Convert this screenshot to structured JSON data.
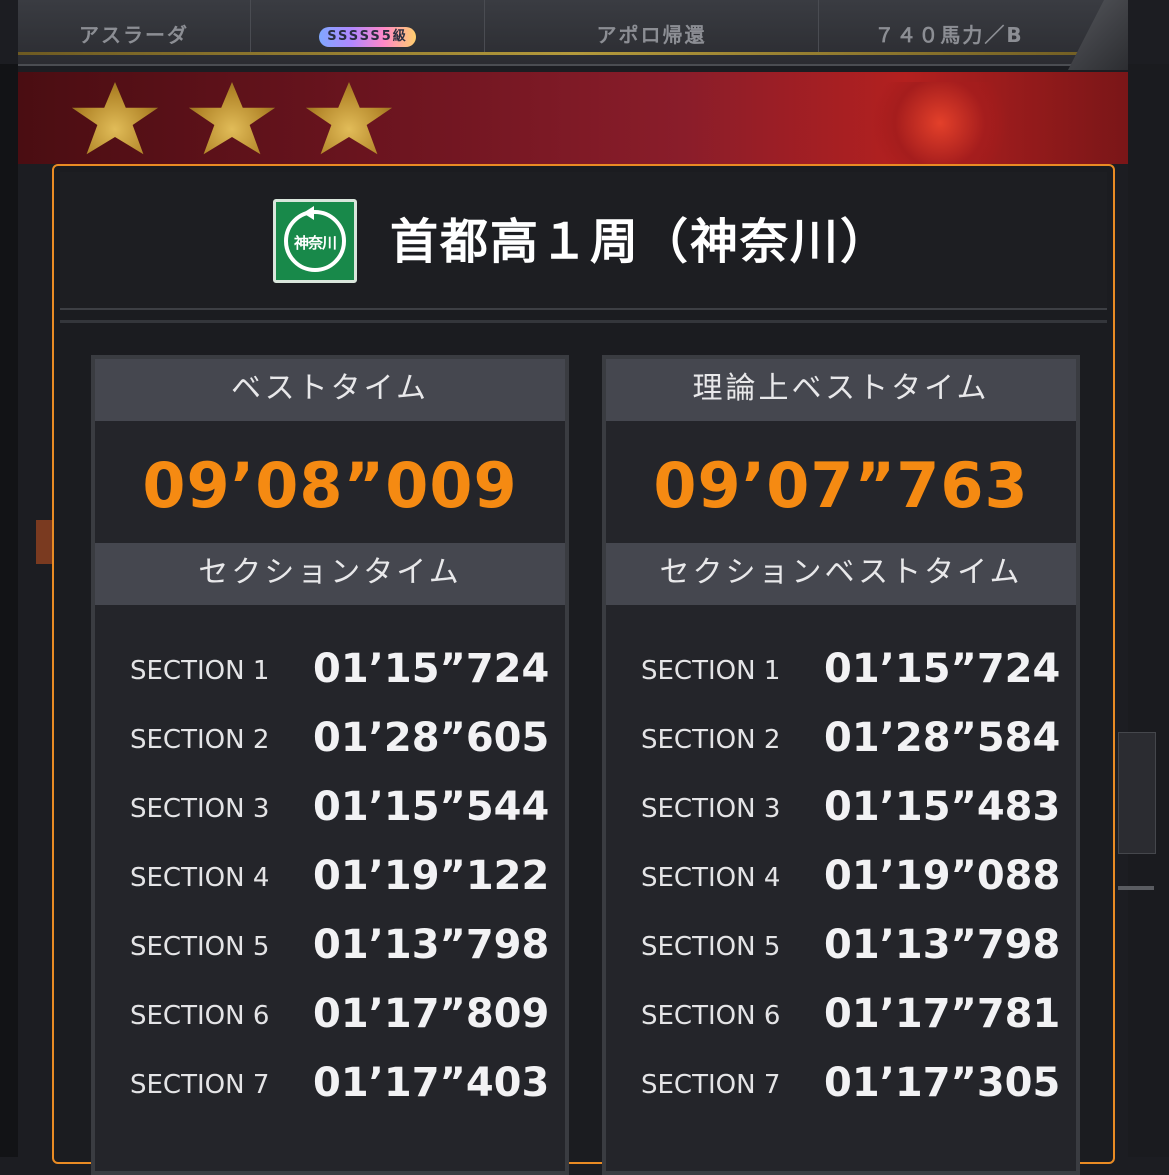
{
  "top_bar": {
    "car_name": "アスラーダ",
    "rank": "SSSSS5級",
    "team": "アポロ帰還",
    "power": "７４０馬力／B"
  },
  "dialog": {
    "course_icon_label": "神奈川",
    "course_title": "首都高１周（神奈川）",
    "best": {
      "header": "ベストタイム",
      "time": "09’08”009",
      "sections_header": "セクションタイム",
      "sections": [
        {
          "label": "SECTION 1",
          "time": "01’15”724"
        },
        {
          "label": "SECTION 2",
          "time": "01’28”605"
        },
        {
          "label": "SECTION 3",
          "time": "01’15”544"
        },
        {
          "label": "SECTION 4",
          "time": "01’19”122"
        },
        {
          "label": "SECTION 5",
          "time": "01’13”798"
        },
        {
          "label": "SECTION 6",
          "time": "01’17”809"
        },
        {
          "label": "SECTION 7",
          "time": "01’17”403"
        }
      ]
    },
    "theoretical": {
      "header": "理論上ベストタイム",
      "time": "09’07”763",
      "sections_header": "セクションベストタイム",
      "sections": [
        {
          "label": "SECTION 1",
          "time": "01’15”724"
        },
        {
          "label": "SECTION 2",
          "time": "01’28”584"
        },
        {
          "label": "SECTION 3",
          "time": "01’15”483"
        },
        {
          "label": "SECTION 4",
          "time": "01’19”088"
        },
        {
          "label": "SECTION 5",
          "time": "01’13”798"
        },
        {
          "label": "SECTION 6",
          "time": "01’17”781"
        },
        {
          "label": "SECTION 7",
          "time": "01’17”305"
        }
      ]
    }
  },
  "colors": {
    "accent_orange": "#f58a12",
    "dialog_border": "#e98b24",
    "course_icon_green": "#18894a"
  }
}
